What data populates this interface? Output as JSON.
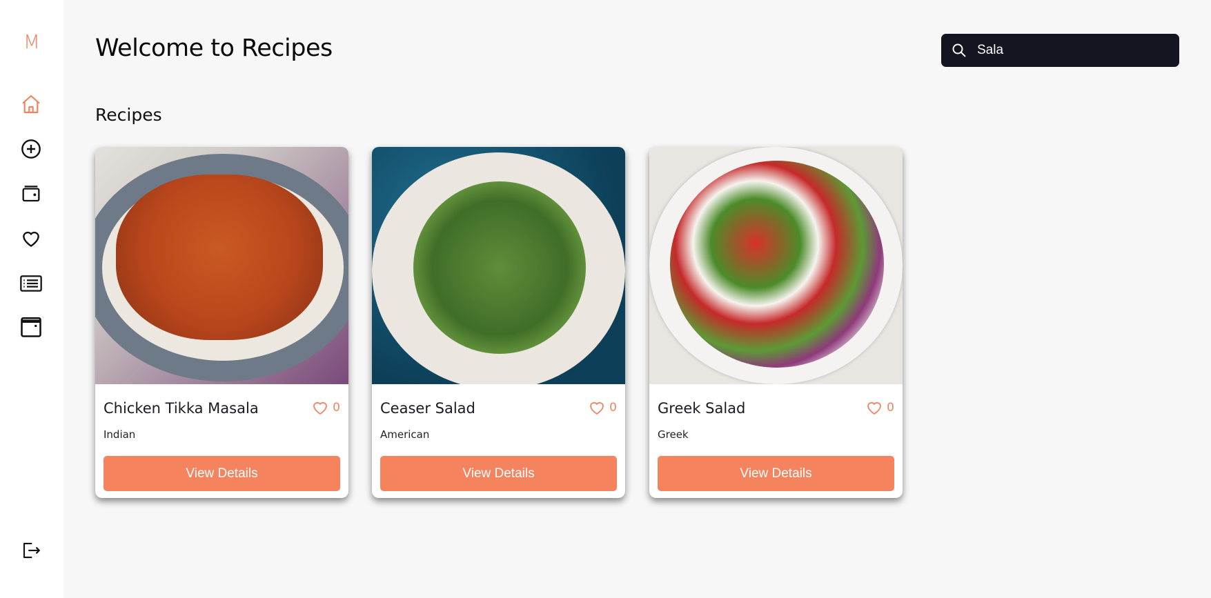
{
  "sidebar": {
    "logo": "M",
    "items": [
      {
        "icon": "home-icon",
        "active": true
      },
      {
        "icon": "plus-circle-icon"
      },
      {
        "icon": "wallet-icon"
      },
      {
        "icon": "heart-icon"
      },
      {
        "icon": "list-icon"
      },
      {
        "icon": "calendar-icon"
      }
    ],
    "logout_icon": "logout-icon"
  },
  "header": {
    "title": "Welcome to Recipes",
    "search_value": "Sala"
  },
  "section_title": "Recipes",
  "accent": "#f5835d",
  "recipes": [
    {
      "title": "Chicken Tikka Masala",
      "cuisine": "Indian",
      "likes": "0",
      "button": "View Details"
    },
    {
      "title": "Ceaser Salad",
      "cuisine": "American",
      "likes": "0",
      "button": "View Details"
    },
    {
      "title": "Greek Salad",
      "cuisine": "Greek",
      "likes": "0",
      "button": "View Details"
    }
  ]
}
